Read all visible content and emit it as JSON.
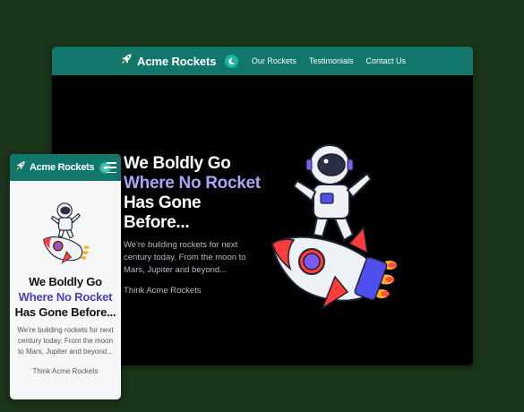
{
  "brand": {
    "name": "Acme Rockets",
    "logo_icon": "rocket-icon"
  },
  "theme": {
    "nav_bg": "#12776b",
    "accent_desktop": "#a7a6f8",
    "accent_mobile": "#4c3fb2",
    "page_bg": "#1a3519"
  },
  "desktop": {
    "nav_links": [
      "Our Rockets",
      "Testimonials",
      "Contact Us"
    ],
    "toggle_icon": "moon-icon",
    "hero": {
      "line1": "We Boldly Go",
      "accent": "Where No Rocket",
      "line3": "Has Gone Before...",
      "description": "We're building rockets for next century today. From the moon to Mars, Jupiter and beyond...",
      "tagline": "Think Acme Rockets"
    }
  },
  "mobile": {
    "toggle_icon": "sun-icon",
    "menu_icon": "hamburger-icon",
    "hero": {
      "line1": "We Boldly Go",
      "accent": "Where No Rocket",
      "line3": "Has Gone Before...",
      "description": "We're building rockets for next century today. From the moon to Mars, Jupiter and beyond...",
      "tagline": "Think Acme Rockets"
    }
  }
}
